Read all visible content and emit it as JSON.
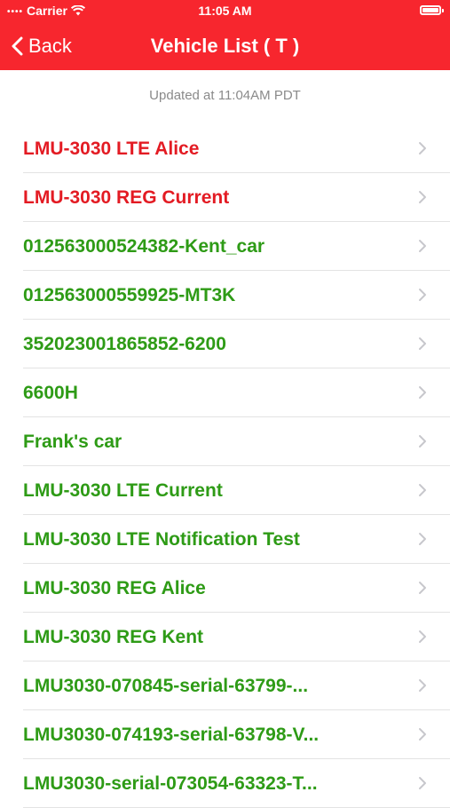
{
  "status_bar": {
    "carrier": "Carrier",
    "time": "11:05 AM"
  },
  "nav": {
    "back_label": "Back",
    "title": "Vehicle List ( T )"
  },
  "updated_text": "Updated at 11:04AM PDT",
  "colors": {
    "header_bg": "#f7262e",
    "red_text": "#e31b23",
    "green_text": "#2e9b16",
    "chevron": "#c7c7cc"
  },
  "vehicles": [
    {
      "label": "LMU-3030 LTE Alice",
      "status": "red"
    },
    {
      "label": "LMU-3030 REG Current",
      "status": "red"
    },
    {
      "label": "012563000524382-Kent_car",
      "status": "green"
    },
    {
      "label": "012563000559925-MT3K",
      "status": "green"
    },
    {
      "label": "352023001865852-6200",
      "status": "green"
    },
    {
      "label": "6600H",
      "status": "green"
    },
    {
      "label": "Frank's car",
      "status": "green"
    },
    {
      "label": "LMU-3030 LTE Current",
      "status": "green"
    },
    {
      "label": "LMU-3030 LTE Notification Test",
      "status": "green"
    },
    {
      "label": "LMU-3030 REG Alice",
      "status": "green"
    },
    {
      "label": "LMU-3030 REG Kent",
      "status": "green"
    },
    {
      "label": "LMU3030-070845-serial-63799-...",
      "status": "green"
    },
    {
      "label": "LMU3030-074193-serial-63798-V...",
      "status": "green"
    },
    {
      "label": "LMU3030-serial-073054-63323-T...",
      "status": "green"
    }
  ]
}
